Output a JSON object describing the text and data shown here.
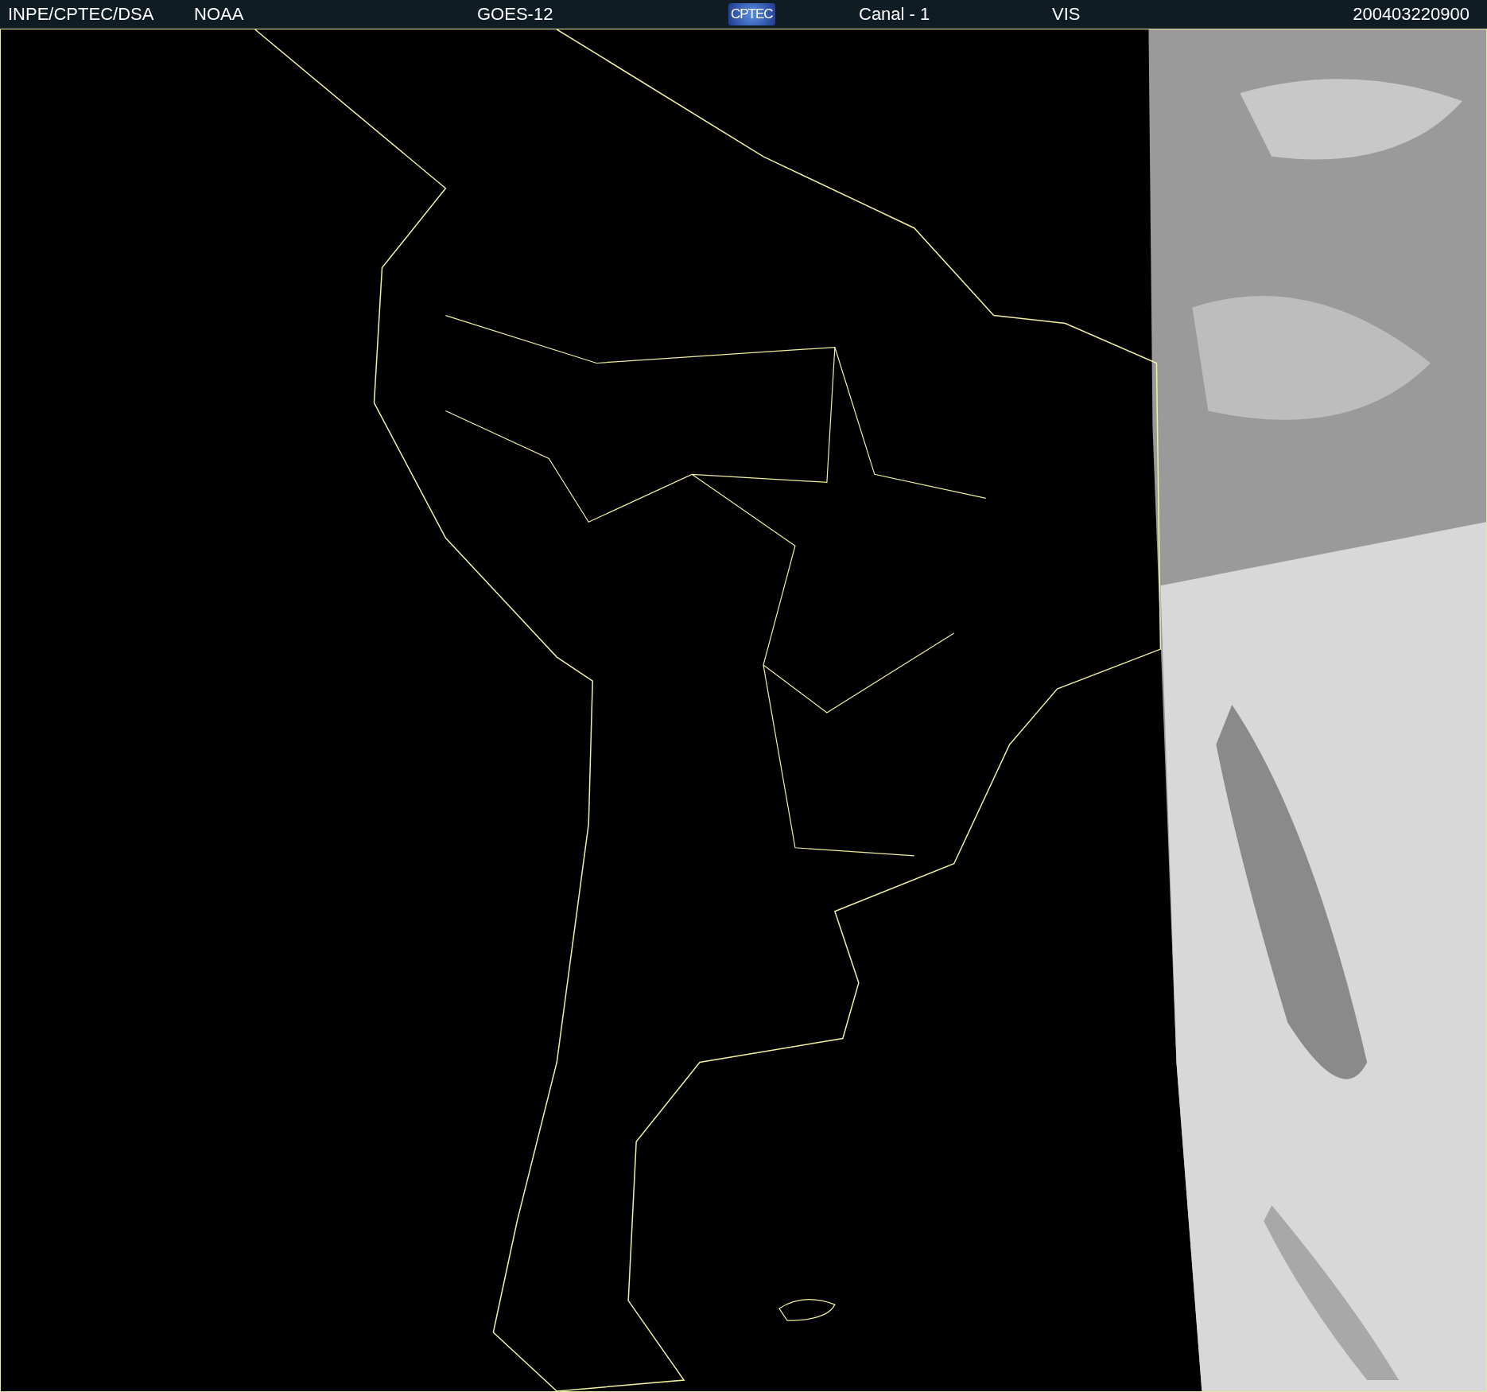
{
  "header": {
    "source": "INPE/CPTEC/DSA",
    "agency": "NOAA",
    "satellite": "GOES-12",
    "logo": "CPTEC",
    "channel": "Canal - 1",
    "band": "VIS",
    "timestamp": "200403220900"
  }
}
